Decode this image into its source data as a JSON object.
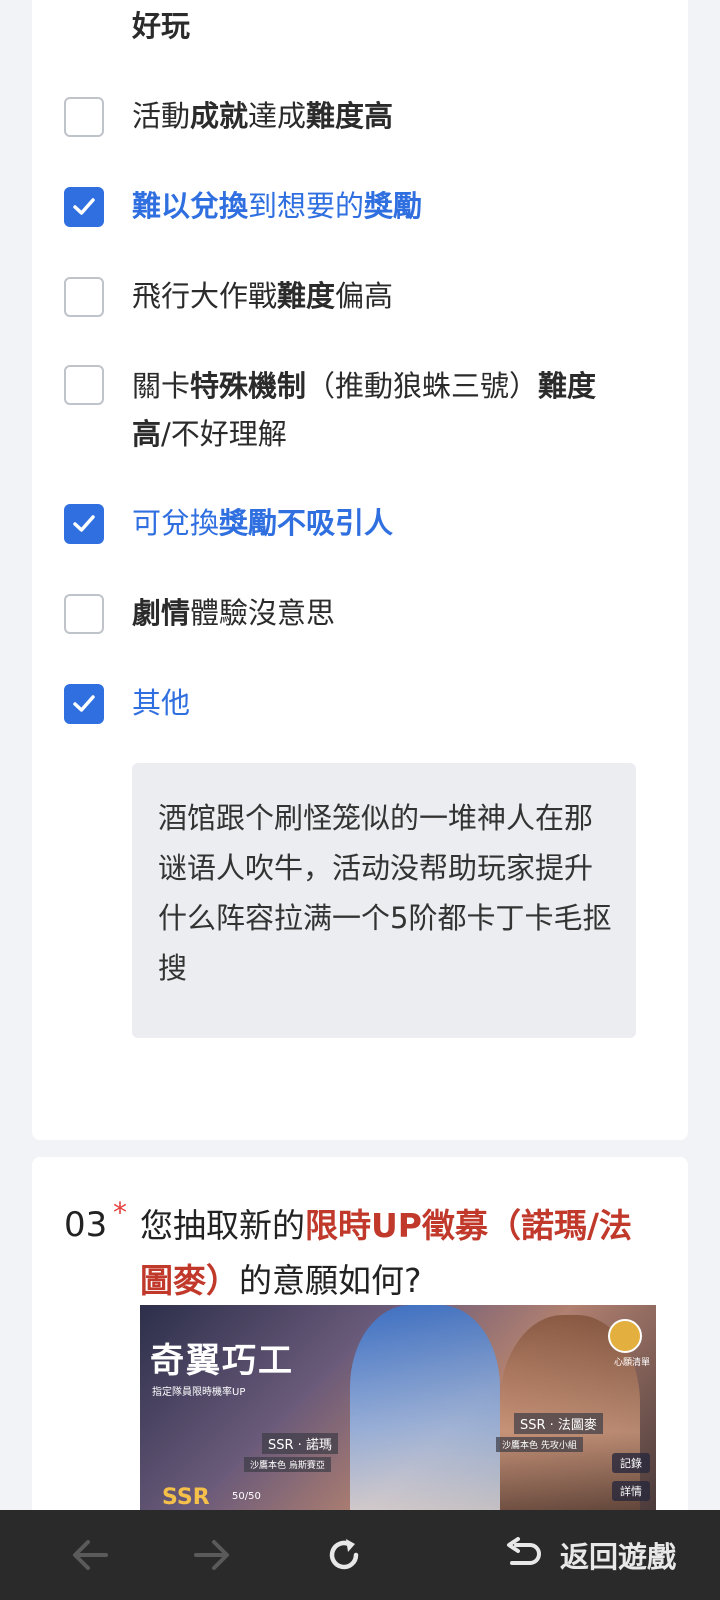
{
  "question2": {
    "prev_option_tail": "好玩",
    "options": [
      {
        "checked": false,
        "parts": [
          {
            "t": "活動",
            "b": false
          },
          {
            "t": "成就",
            "b": true
          },
          {
            "t": "達成",
            "b": false
          },
          {
            "t": "難度高",
            "b": true
          }
        ]
      },
      {
        "checked": true,
        "parts": [
          {
            "t": "難以兌換",
            "b": true
          },
          {
            "t": "到想要的",
            "b": false
          },
          {
            "t": "獎勵",
            "b": true
          }
        ]
      },
      {
        "checked": false,
        "parts": [
          {
            "t": "飛行大作戰",
            "b": false
          },
          {
            "t": "難度",
            "b": true
          },
          {
            "t": "偏高",
            "b": false
          }
        ]
      },
      {
        "checked": false,
        "parts": [
          {
            "t": "關卡",
            "b": false
          },
          {
            "t": "特殊機制",
            "b": true
          },
          {
            "t": "（推動狼蛛三號）",
            "b": false
          },
          {
            "t": "難度高",
            "b": true
          },
          {
            "t": "/不好理解",
            "b": false
          }
        ]
      },
      {
        "checked": true,
        "parts": [
          {
            "t": "可兌換",
            "b": false
          },
          {
            "t": "獎勵不吸引人",
            "b": true
          }
        ]
      },
      {
        "checked": false,
        "parts": [
          {
            "t": "劇情",
            "b": true
          },
          {
            "t": "體驗沒意思",
            "b": false
          }
        ]
      },
      {
        "checked": true,
        "parts": [
          {
            "t": "其他",
            "b": false
          }
        ]
      }
    ],
    "other_text": "酒馆跟个刷怪笼似的一堆神人在那谜语人吹牛，活动没帮助玩家提升什么阵容拉满一个5阶都卡丁卡毛抠搜"
  },
  "question3": {
    "number": "03",
    "required_mark": "*",
    "text_before": "您抽取新的",
    "text_highlight": "限時UP徵募（諾瑪/法圖麥）",
    "text_after": "的意願如何?",
    "banner": {
      "title": "奇翼巧工",
      "subtitle": "指定隊員限時機率UP",
      "char1": "SSR · 諾瑪",
      "char1_sub1": "沙鷹本色",
      "char1_sub2": "烏斯賽亞",
      "char2": "SSR · 法圖麥",
      "char2_sub1": "沙鷹本色",
      "char2_sub2": "先攻小組",
      "ssr": "SSR",
      "count": "50/50",
      "btn_records": "記錄",
      "btn_details": "詳情",
      "icon_label": "心願清單"
    }
  },
  "navbar": {
    "back_label": "返回遊戲"
  },
  "colors": {
    "accent": "#2f6fe0",
    "highlight_red": "#c0392b",
    "required_red": "#e54040",
    "navbar_bg": "#2a2a2a"
  }
}
